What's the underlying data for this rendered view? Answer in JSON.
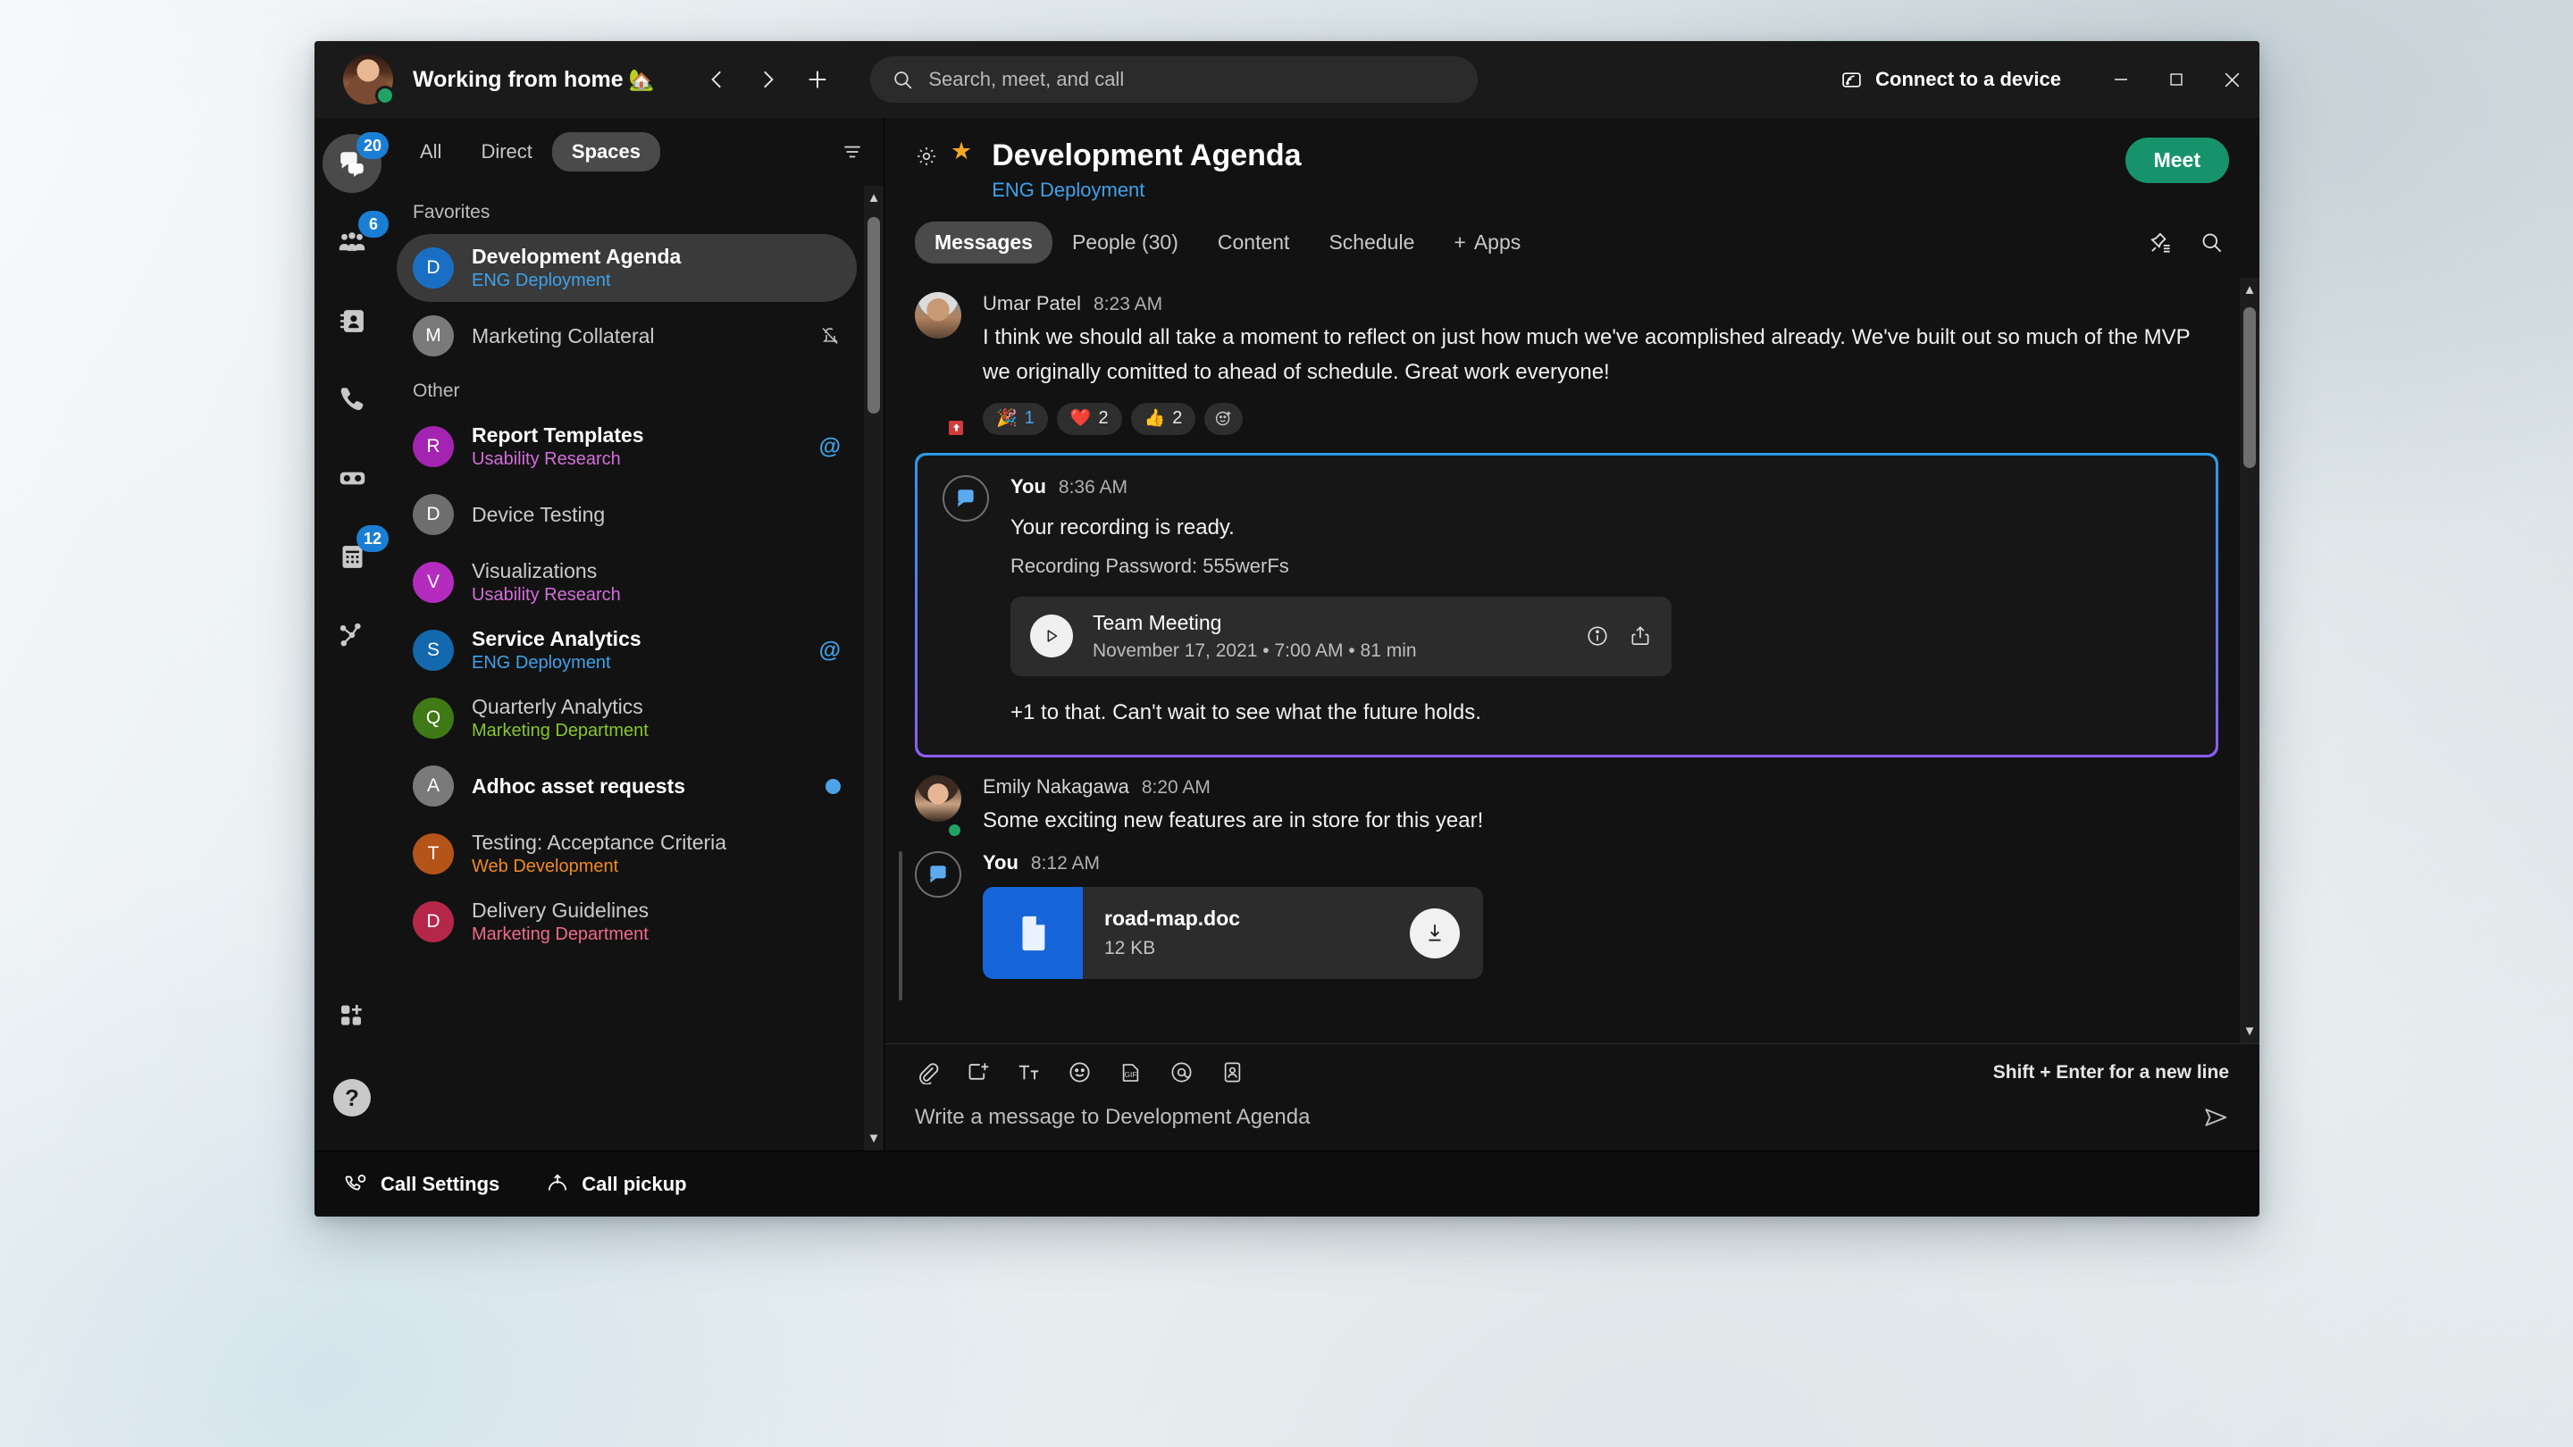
{
  "titlebar": {
    "status_text": "Working from home",
    "status_emoji": "🏡",
    "back_icon": "chevron-left-icon",
    "forward_icon": "chevron-right-icon",
    "add_icon": "plus-icon",
    "connect_label": "Connect to a device",
    "minimize_label": "—",
    "maximize_label": "□",
    "close_label": "✕"
  },
  "search": {
    "placeholder": "Search, meet, and call"
  },
  "rail": {
    "items": [
      {
        "name": "messaging",
        "icon": "chat-bubbles-icon",
        "badge": "20",
        "active": true
      },
      {
        "name": "teams",
        "icon": "people-icon",
        "badge": "6",
        "active": false
      },
      {
        "name": "contacts",
        "icon": "contact-card-icon",
        "badge": "",
        "active": false
      },
      {
        "name": "calling",
        "icon": "phone-icon",
        "badge": "",
        "active": false
      },
      {
        "name": "voicemail",
        "icon": "voicemail-icon",
        "badge": "",
        "active": false
      },
      {
        "name": "calendar",
        "icon": "calendar-icon",
        "badge": "12",
        "active": false
      },
      {
        "name": "workflows",
        "icon": "nodes-icon",
        "badge": "",
        "active": false
      }
    ],
    "bottom": [
      {
        "name": "add-apps",
        "icon": "apps-add-icon"
      },
      {
        "name": "help",
        "icon": "help-icon",
        "glyph": "?"
      }
    ]
  },
  "spaces_panel": {
    "filters": [
      {
        "label": "All",
        "active": false
      },
      {
        "label": "Direct",
        "active": false
      },
      {
        "label": "Spaces",
        "active": true
      }
    ],
    "filter_icon": "filter-lines-icon",
    "groups": [
      {
        "label": "Favorites",
        "items": [
          {
            "initial": "D",
            "color": "#1a6fc4",
            "name": "Development Agenda",
            "sub": "ENG Deployment",
            "sub_color": "#3fa2ea",
            "unread": true,
            "selected": true,
            "badge": "none"
          },
          {
            "initial": "M",
            "color": "#7a7a7a",
            "name": "Marketing Collateral",
            "sub": "",
            "sub_color": "",
            "unread": false,
            "selected": false,
            "badge": "mute"
          }
        ]
      },
      {
        "label": "Other",
        "items": [
          {
            "initial": "R",
            "color": "#a324b0",
            "name": "Report Templates",
            "sub": "Usability Research",
            "sub_color": "#d46edb",
            "unread": true,
            "selected": false,
            "badge": "at"
          },
          {
            "initial": "D",
            "color": "#6e6e6e",
            "name": "Device Testing",
            "sub": "",
            "sub_color": "",
            "unread": false,
            "selected": false,
            "badge": "none"
          },
          {
            "initial": "V",
            "color": "#b32cbe",
            "name": "Visualizations",
            "sub": "Usability Research",
            "sub_color": "#d46edb",
            "unread": false,
            "selected": false,
            "badge": "none"
          },
          {
            "initial": "S",
            "color": "#1368ae",
            "name": "Service Analytics",
            "sub": "ENG Deployment",
            "sub_color": "#3fa2ea",
            "unread": true,
            "selected": false,
            "badge": "at"
          },
          {
            "initial": "Q",
            "color": "#3f7a16",
            "name": "Quarterly Analytics",
            "sub": "Marketing Department",
            "sub_color": "#86c72c",
            "unread": false,
            "selected": false,
            "badge": "none"
          },
          {
            "initial": "A",
            "color": "#7a7a7a",
            "name": "Adhoc asset requests",
            "sub": "",
            "sub_color": "",
            "unread": true,
            "selected": false,
            "badge": "dot"
          },
          {
            "initial": "T",
            "color": "#b55418",
            "name": "Testing: Acceptance Criteria",
            "sub": "Web Development",
            "sub_color": "#f08a20",
            "unread": false,
            "selected": false,
            "badge": "none"
          },
          {
            "initial": "D",
            "color": "#b52749",
            "name": "Delivery Guidelines",
            "sub": "Marketing Department",
            "sub_color": "#f06a8a",
            "unread": false,
            "selected": false,
            "badge": "none"
          }
        ]
      }
    ]
  },
  "space_header": {
    "gear_icon": "gear-icon",
    "star_icon": "star-icon",
    "star_glyph": "★",
    "title": "Development Agenda",
    "subtitle": "ENG Deployment",
    "meet_label": "Meet",
    "meet_color": "#17936b",
    "tabs": [
      {
        "label": "Messages",
        "active": true
      },
      {
        "label": "People (30)",
        "active": false
      },
      {
        "label": "Content",
        "active": false
      },
      {
        "label": "Schedule",
        "active": false
      }
    ],
    "apps_label": "Apps",
    "apps_plus": "+",
    "right_icons": [
      {
        "name": "pinned-messages-icon"
      },
      {
        "name": "search-icon"
      }
    ]
  },
  "messages": [
    {
      "author": "Umar Patel",
      "time": "8:23 AM",
      "is_you": false,
      "avatar": "umar-avatar",
      "presence": "dnd",
      "text": "I think we should all take a moment to reflect on just how much we've acomplished already. We've built out so much of the MVP we originally comitted to ahead of schedule. Great work everyone!",
      "reactions": [
        {
          "emoji": "🎉",
          "count": "1",
          "mine": true
        },
        {
          "emoji": "❤️",
          "count": "2",
          "mine": false
        },
        {
          "emoji": "👍",
          "count": "2",
          "mine": false
        }
      ],
      "add_reaction_icon": "add-reaction-icon"
    },
    {
      "author": "You",
      "time": "8:36 AM",
      "is_you": true,
      "avatar": "bot-avatar",
      "highlighted": true,
      "headline": "Your recording is ready.",
      "password_line": "Recording Password: 555werFs",
      "recording": {
        "play_icon": "play-icon",
        "title": "Team Meeting",
        "meta": "November 17, 2021  •  7:00 AM  •  81 min",
        "info_icon": "info-icon",
        "share_icon": "share-icon"
      },
      "footer_text": "+1 to that. Can't wait to see what the future holds."
    },
    {
      "author": "Emily Nakagawa",
      "time": "8:20 AM",
      "is_you": false,
      "avatar": "emily-avatar",
      "presence": "online",
      "text": "Some exciting new features are in store for this year!"
    },
    {
      "author": "You",
      "time": "8:12 AM",
      "is_you": true,
      "avatar": "bot-avatar",
      "file": {
        "name": "road-map.doc",
        "size": "12 KB",
        "thumb_icon": "document-icon",
        "download_icon": "download-icon"
      }
    }
  ],
  "composer": {
    "icons": [
      {
        "name": "attach-icon"
      },
      {
        "name": "screen-capture-icon"
      },
      {
        "name": "format-text-icon"
      },
      {
        "name": "emoji-icon"
      },
      {
        "name": "gif-icon",
        "glyph": "GIF"
      },
      {
        "name": "mention-icon",
        "glyph": "@"
      },
      {
        "name": "person-card-icon"
      }
    ],
    "hint": "Shift + Enter for a new line",
    "placeholder": "Write a message to Development Agenda",
    "send_icon": "send-icon"
  },
  "statusbar": {
    "items": [
      {
        "label": "Call Settings",
        "icon": "call-settings-icon"
      },
      {
        "label": "Call pickup",
        "icon": "call-pickup-icon"
      }
    ]
  }
}
